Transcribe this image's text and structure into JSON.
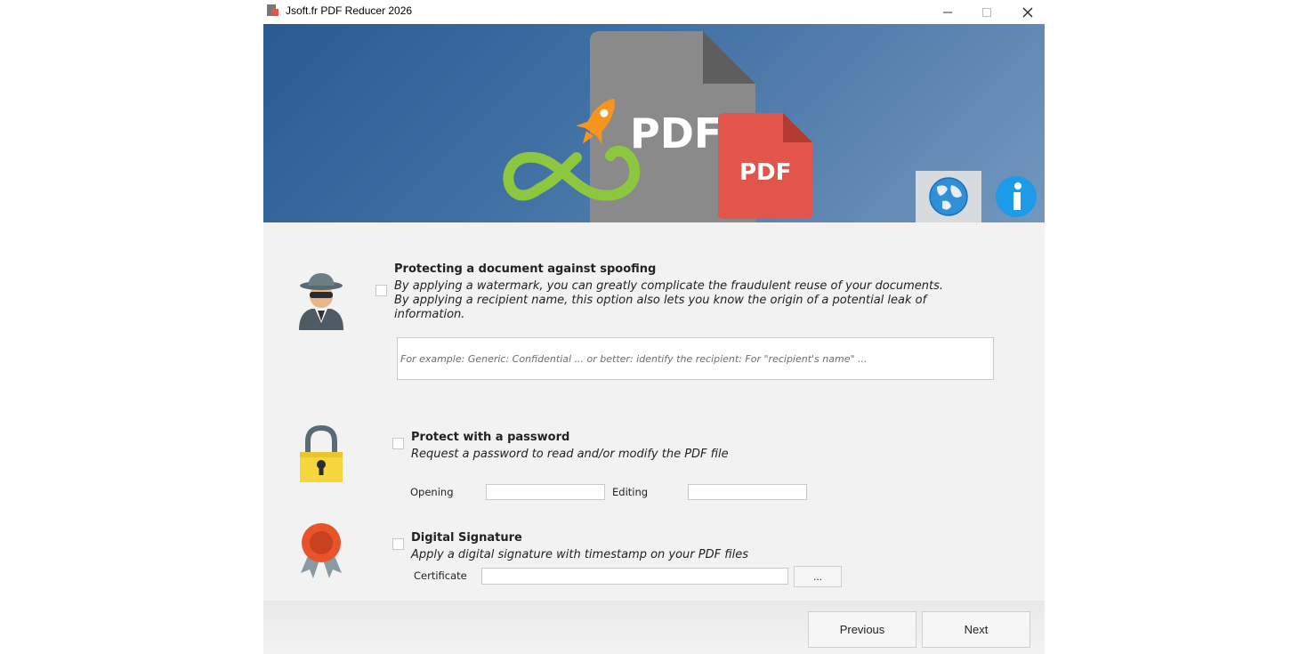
{
  "window": {
    "title": "Jsoft.fr PDF Reducer 2026",
    "controls": {
      "minimize": "—",
      "maximize": "☐",
      "close": "✕"
    }
  },
  "banner": {
    "big_doc_text": "PDF",
    "red_doc_text": "PDF",
    "language_button_icon": "globe-icon",
    "info_button_icon": "info-icon"
  },
  "spoofing": {
    "heading": "Protecting a document against spoofing",
    "desc_line1": "By applying a watermark, you can greatly complicate the fraudulent reuse of your documents.",
    "desc_line2": "By applying a recipient name, this option also lets you know the origin of a potential leak of",
    "desc_line3": "information.",
    "watermark_placeholder": "For example: Generic: Confidential ... or better: identify the recipient: For \"recipient's name\" ...",
    "watermark_value": "",
    "checked": false
  },
  "password": {
    "heading": "Protect with a password",
    "desc": "Request a password to read and/or modify the PDF file",
    "opening_label": "Opening",
    "editing_label": "Editing",
    "opening_value": "",
    "editing_value": "",
    "checked": false
  },
  "signature": {
    "heading": "Digital Signature",
    "desc": "Apply a digital signature with timestamp on your PDF files",
    "certificate_label": "Certificate",
    "certificate_value": "",
    "browse_label": "...",
    "checked": false
  },
  "footer": {
    "previous_label": "Previous",
    "next_label": "Next"
  },
  "colors": {
    "banner_start": "#2b5a92",
    "banner_end": "#7397be",
    "pdf_gray": "#8a8a8a",
    "pdf_red": "#e2554a",
    "rocket_orange": "#f7941d",
    "infinity_green": "#8dc63f"
  }
}
